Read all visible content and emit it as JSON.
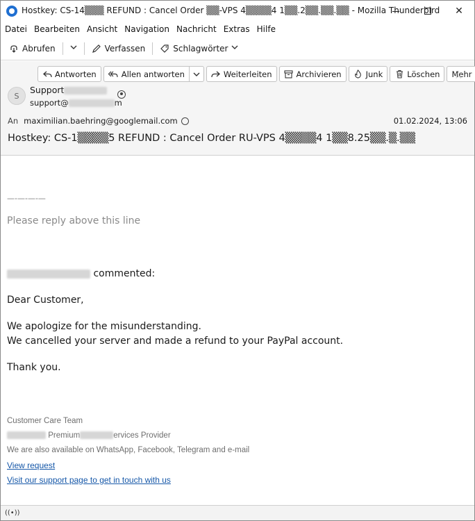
{
  "window": {
    "title": "Hostkey: CS-14▒▒▒ REFUND : Cancel Order ▒▒-VPS 4▒▒▒▒4 1▒▒.2▒▒.▒▒.▒▒ - Mozilla Thunderbird",
    "minimize_glyph": "",
    "close_glyph": "✕"
  },
  "menu": {
    "items": [
      {
        "label": "Datei"
      },
      {
        "label": "Bearbeiten"
      },
      {
        "label": "Ansicht"
      },
      {
        "label": "Navigation"
      },
      {
        "label": "Nachricht"
      },
      {
        "label": "Extras"
      },
      {
        "label": "Hilfe"
      }
    ]
  },
  "toolbar": {
    "fetch_label": "Abrufen",
    "compose_label": "Verfassen",
    "tags_label": "Schlagwörter",
    "fetch_icon": "download-icon",
    "compose_icon": "pencil-icon",
    "tags_icon": "tag-icon"
  },
  "actions": {
    "reply": "Antworten",
    "reply_all": "Allen antworten",
    "forward": "Weiterleiten",
    "archive": "Archivieren",
    "junk": "Junk",
    "delete": "Löschen",
    "more": "Mehr"
  },
  "message": {
    "avatar_letter": "S",
    "sender_name_prefix": "Support",
    "sender_email_prefix": "support@",
    "sender_email_suffix": "m",
    "to_label": "An",
    "to_address": "maximilian.baehring@googlemail.com",
    "date": "01.02.2024, 13:06",
    "subject": "Hostkey: CS-1▒▒▒▒5 REFUND : Cancel Order RU-VPS 4▒▒▒▒4 1▒▒8.25▒▒.▒.▒▒"
  },
  "body": {
    "divider": "—-—-—-—",
    "reply_hint": "Please reply above this line",
    "commenter_suffix": "commented:",
    "greeting": "Dear Customer,",
    "line1": "We apologize for the misunderstanding.",
    "line2": "We cancelled your server and made a refund to your PayPal account.",
    "thanks": "Thank you.",
    "sig_team": "Customer Care Team",
    "sig_provider_mid": "Premium",
    "sig_provider_end": "ervices Provider",
    "sig_channels": "We are also available on WhatsApp, Facebook, Telegram and e-mail",
    "link_view_request": "View request",
    "link_support_page": "Visit our support page to get in touch with us"
  },
  "status": {
    "icon": "((•))"
  }
}
